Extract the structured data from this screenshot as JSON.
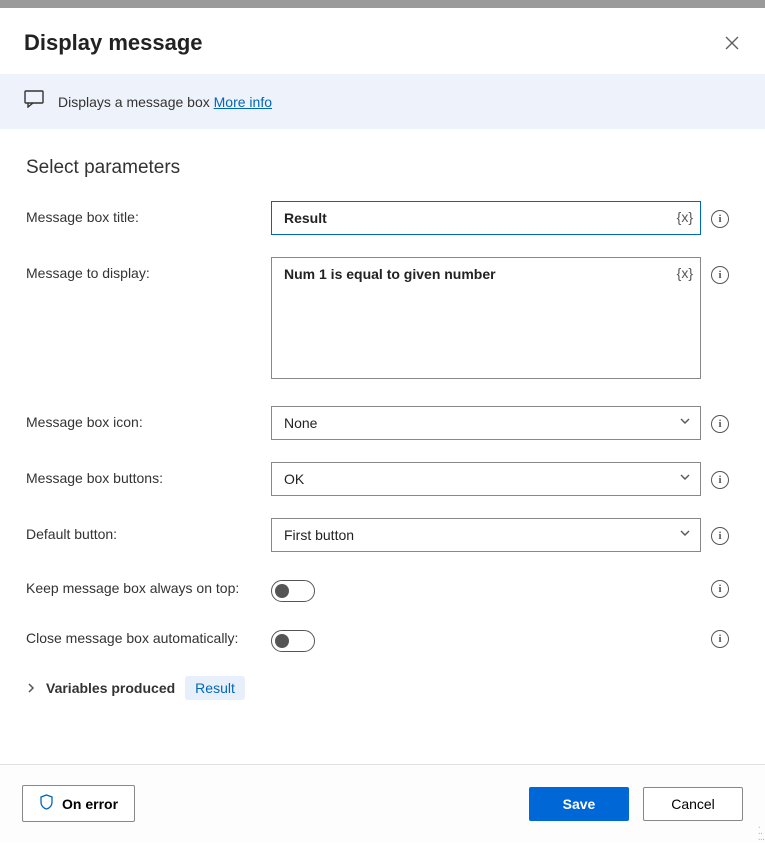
{
  "header": {
    "title": "Display message"
  },
  "banner": {
    "text": "Displays a message box ",
    "link": "More info"
  },
  "section": {
    "title": "Select parameters"
  },
  "fields": {
    "title_label": "Message box title:",
    "title_value": "Result",
    "message_label": "Message to display:",
    "message_value": "Num 1 is equal to given number",
    "icon_label": "Message box icon:",
    "icon_value": "None",
    "buttons_label": "Message box buttons:",
    "buttons_value": "OK",
    "default_label": "Default button:",
    "default_value": "First button",
    "ontop_label": "Keep message box always on top:",
    "autoclose_label": "Close message box automatically:"
  },
  "variables": {
    "label": "Variables produced",
    "chip": "Result"
  },
  "footer": {
    "onerror": "On error",
    "save": "Save",
    "cancel": "Cancel"
  },
  "glyphs": {
    "varx": "{x}",
    "info": "i"
  }
}
